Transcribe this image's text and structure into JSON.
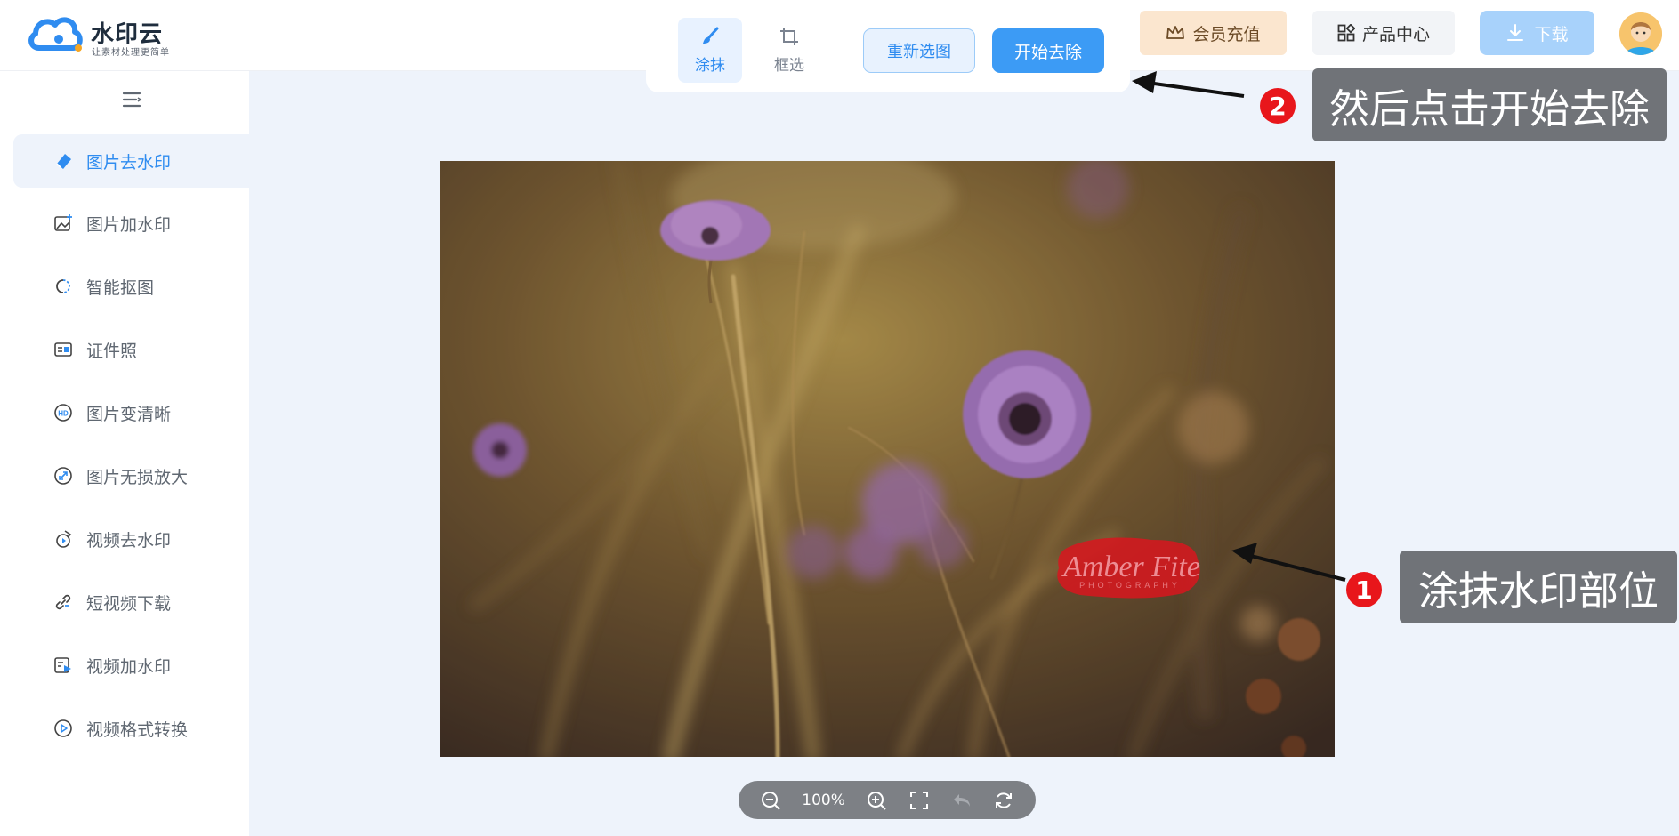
{
  "header": {
    "logo_title": "水印云",
    "logo_slogan": "让素材处理更简单",
    "vip_label": "会员充值",
    "products_label": "产品中心",
    "download_label": "下载"
  },
  "sidebar": {
    "items": [
      {
        "label": "图片去水印",
        "icon": "eraser-icon"
      },
      {
        "label": "图片加水印",
        "icon": "image-add-icon"
      },
      {
        "label": "智能抠图",
        "icon": "cutout-icon"
      },
      {
        "label": "证件照",
        "icon": "id-card-icon"
      },
      {
        "label": "图片变清晰",
        "icon": "hd-icon"
      },
      {
        "label": "图片无损放大",
        "icon": "enlarge-icon"
      },
      {
        "label": "视频去水印",
        "icon": "video-erase-icon"
      },
      {
        "label": "短视频下载",
        "icon": "link-icon"
      },
      {
        "label": "视频加水印",
        "icon": "video-add-icon"
      },
      {
        "label": "视频格式转换",
        "icon": "play-circle-icon"
      }
    ],
    "active_index": 0
  },
  "toolbar": {
    "smear_label": "涂抹",
    "box_label": "框选",
    "reselect_label": "重新选图",
    "start_label": "开始去除"
  },
  "canvas": {
    "watermark_text": "Amber Fite",
    "watermark_subtext": "PHOTOGRAPHY"
  },
  "zoom": {
    "level": "100%"
  },
  "annotations": {
    "step1_number": "1",
    "step1_text": "涂抹水印部位",
    "step2_number": "2",
    "step2_text": "然后点击开始去除"
  },
  "colors": {
    "accent": "#3c9bf5",
    "vip_bg": "#fbe6cf",
    "badge_red": "#e8161b",
    "callout_gray": "#707378"
  }
}
